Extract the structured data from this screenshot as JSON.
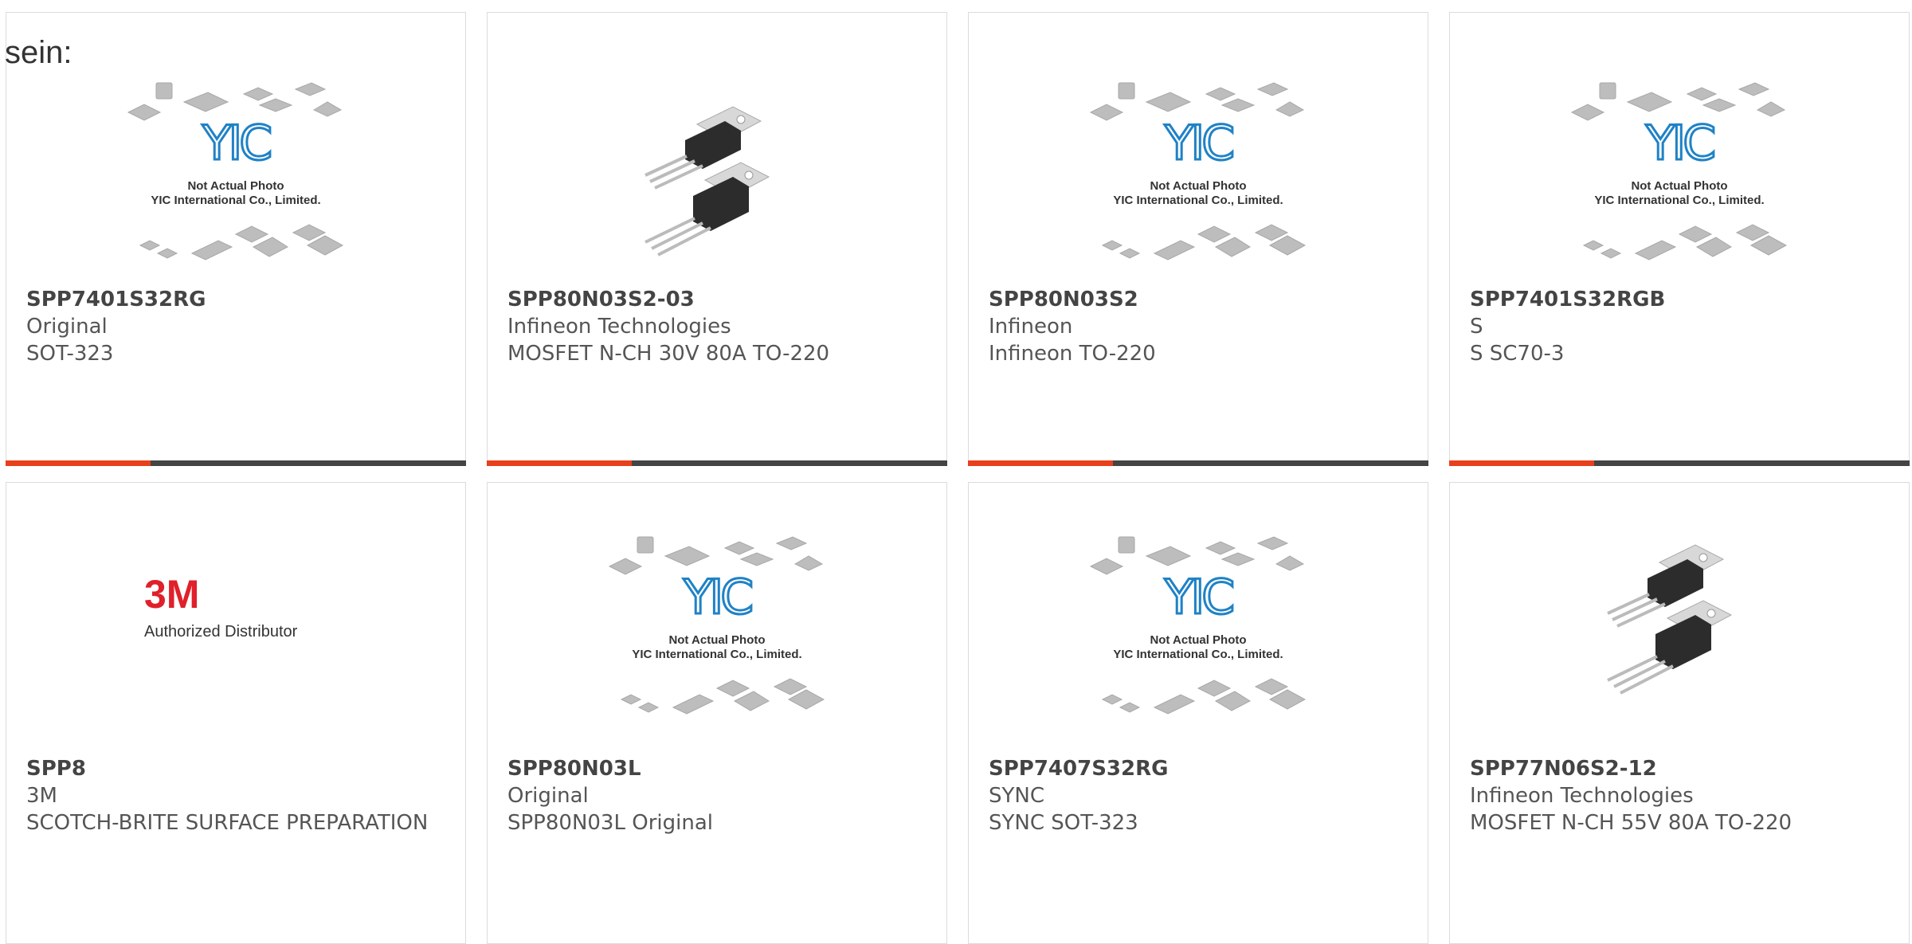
{
  "intro": "sein:",
  "placeholder_image": {
    "brand": "YIC",
    "line1": "Not Actual Photo",
    "line2": "YIC International Co., Limited."
  },
  "brand_logo": {
    "mark": "3M",
    "caption": "Authorized Distributor"
  },
  "colors": {
    "accent": "#e8401c",
    "bar": "#444444",
    "yic_blue": "#1f82c6",
    "logo_red": "#e0202a"
  },
  "products": [
    {
      "part": "SPP7401S32RG",
      "maker": "Original",
      "desc": "SOT-323",
      "image": "yic-placeholder"
    },
    {
      "part": "SPP80N03S2-03",
      "maker": "Infineon Technologies",
      "desc": "MOSFET N-CH 30V 80A TO-220",
      "image": "to220-transistor"
    },
    {
      "part": "SPP80N03S2",
      "maker": "Infineon",
      "desc": "Infineon TO-220",
      "image": "yic-placeholder"
    },
    {
      "part": "SPP7401S32RGB",
      "maker": "S",
      "desc": "S SC70-3",
      "image": "yic-placeholder"
    },
    {
      "part": "SPP8",
      "maker": "3M",
      "desc": "SCOTCH-BRITE SURFACE PREPARATION",
      "image": "3m-logo"
    },
    {
      "part": "SPP80N03L",
      "maker": "Original",
      "desc": "SPP80N03L Original",
      "image": "yic-placeholder"
    },
    {
      "part": "SPP7407S32RG",
      "maker": "SYNC",
      "desc": "SYNC SOT-323",
      "image": "yic-placeholder"
    },
    {
      "part": "SPP77N06S2-12",
      "maker": "Infineon Technologies",
      "desc": "MOSFET N-CH 55V 80A TO-220",
      "image": "to220-transistor"
    }
  ]
}
